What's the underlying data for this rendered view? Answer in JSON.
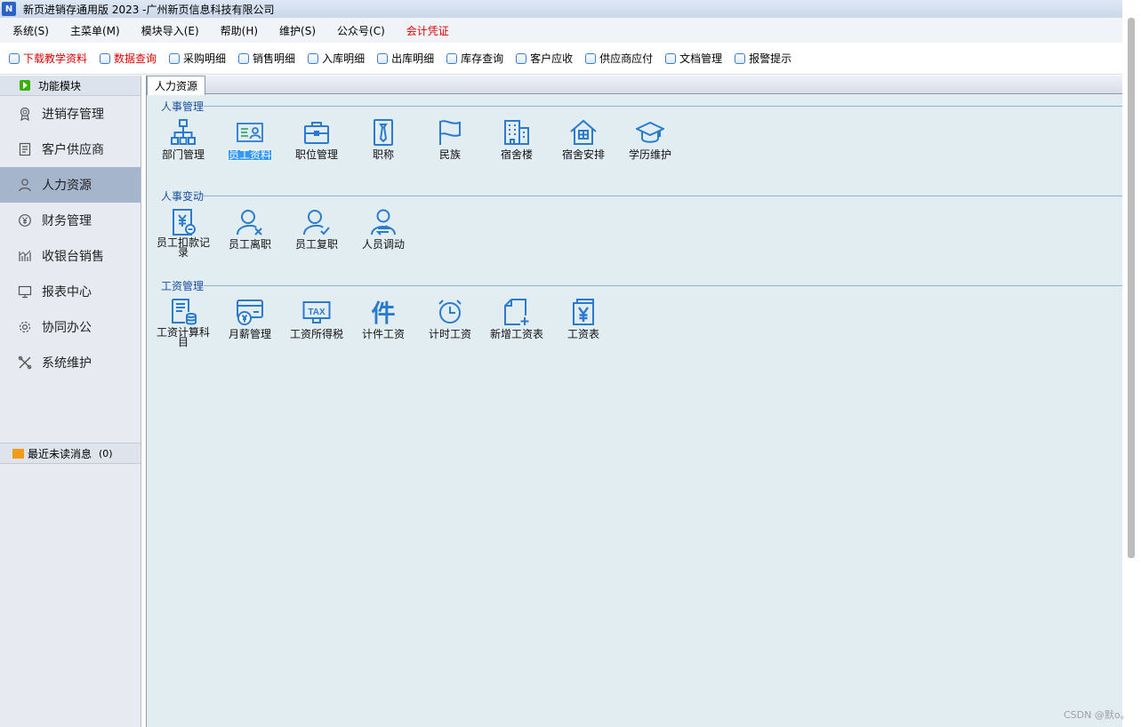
{
  "window": {
    "title": "新页进销存通用版 2023 -广州新页信息科技有限公司",
    "icon": "app-logo-icon"
  },
  "menu": [
    {
      "label": "系统(S)"
    },
    {
      "label": "主菜单(M)"
    },
    {
      "label": "模块导入(E)"
    },
    {
      "label": "帮助(H)"
    },
    {
      "label": "维护(S)"
    },
    {
      "label": "公众号(C)"
    },
    {
      "label": "会计凭证",
      "color": "#e00000"
    }
  ],
  "toolbar": [
    {
      "label": "下载教学资料",
      "color": "#e00000"
    },
    {
      "label": "数据查询",
      "color": "#e00000"
    },
    {
      "label": "采购明细"
    },
    {
      "label": "销售明细"
    },
    {
      "label": "入库明细"
    },
    {
      "label": "出库明细"
    },
    {
      "label": "库存查询"
    },
    {
      "label": "客户应收"
    },
    {
      "label": "供应商应付"
    },
    {
      "label": "文档管理"
    },
    {
      "label": "报警提示"
    }
  ],
  "sidebar": {
    "header": "功能模块",
    "items": [
      {
        "label": "进销存管理",
        "icon": "award-icon"
      },
      {
        "label": "客户供应商",
        "icon": "list-icon"
      },
      {
        "label": "人力资源",
        "icon": "person-icon",
        "active": true
      },
      {
        "label": "财务管理",
        "icon": "money-icon"
      },
      {
        "label": "收银台销售",
        "icon": "chart-icon"
      },
      {
        "label": "报表中心",
        "icon": "monitor-icon"
      },
      {
        "label": "协同办公",
        "icon": "gear-icon"
      },
      {
        "label": "系统维护",
        "icon": "tools-icon"
      }
    ],
    "messages": {
      "label": "最近未读消息",
      "count": "(0)"
    }
  },
  "main": {
    "tab": "人力资源",
    "sections": [
      {
        "title": "人事管理",
        "items": [
          {
            "label": "部门管理",
            "icon": "org-chart-icon"
          },
          {
            "label": "员工资料",
            "icon": "id-card-icon",
            "selected": true
          },
          {
            "label": "职位管理",
            "icon": "briefcase-icon"
          },
          {
            "label": "职称",
            "icon": "tie-badge-icon"
          },
          {
            "label": "民族",
            "icon": "flag-icon"
          },
          {
            "label": "宿舍楼",
            "icon": "building-icon"
          },
          {
            "label": "宿舍安排",
            "icon": "house-icon"
          },
          {
            "label": "学历维护",
            "icon": "graduation-cap-icon"
          }
        ]
      },
      {
        "title": "人事变动",
        "items": [
          {
            "label": "员工扣款记录",
            "icon": "deduction-doc-icon"
          },
          {
            "label": "员工离职",
            "icon": "user-remove-icon"
          },
          {
            "label": "员工复职",
            "icon": "user-check-icon"
          },
          {
            "label": "人员调动",
            "icon": "user-transfer-icon"
          }
        ]
      },
      {
        "title": "工资管理",
        "items": [
          {
            "label": "工资计算科目",
            "icon": "salary-calc-icon"
          },
          {
            "label": "月薪管理",
            "icon": "card-yen-icon"
          },
          {
            "label": "工资所得税",
            "icon": "tax-icon"
          },
          {
            "label": "计件工资",
            "icon": "piece-wage-icon"
          },
          {
            "label": "计时工资",
            "icon": "alarm-clock-icon"
          },
          {
            "label": "新增工资表",
            "icon": "new-doc-icon"
          },
          {
            "label": "工资表",
            "icon": "yen-doc-icon"
          }
        ]
      }
    ]
  },
  "watermark": "CSDN @默o。"
}
